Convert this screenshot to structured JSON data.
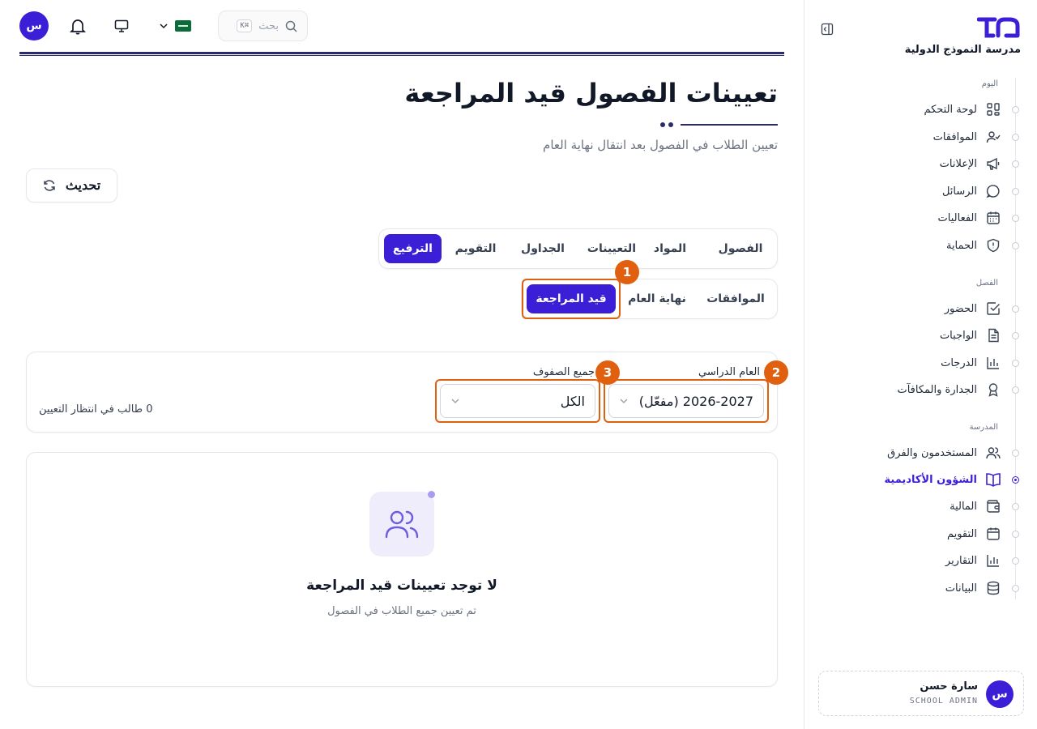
{
  "sidebar": {
    "school_name": "مدرسة النموذج الدولية",
    "sections": [
      {
        "title": "اليوم",
        "items": [
          {
            "label": "لوحة التحكم",
            "icon": "dashboard-icon"
          },
          {
            "label": "الموافقات",
            "icon": "user-check-icon"
          },
          {
            "label": "الإعلانات",
            "icon": "megaphone-icon"
          },
          {
            "label": "الرسائل",
            "icon": "chat-bubble-icon"
          },
          {
            "label": "الفعاليات",
            "icon": "calendar-grid-icon"
          },
          {
            "label": "الحماية",
            "icon": "shield-icon"
          }
        ]
      },
      {
        "title": "الفصل",
        "items": [
          {
            "label": "الحضور",
            "icon": "checkbox-icon"
          },
          {
            "label": "الواجبات",
            "icon": "document-icon"
          },
          {
            "label": "الدرجات",
            "icon": "bar-chart-icon"
          },
          {
            "label": "الجدارة والمكافآت",
            "icon": "award-icon"
          }
        ]
      },
      {
        "title": "المدرسة",
        "items": [
          {
            "label": "المستخدمون والفرق",
            "icon": "users-icon"
          },
          {
            "label": "الشؤون الأكاديمية",
            "icon": "book-open-icon"
          },
          {
            "label": "المالية",
            "icon": "wallet-icon"
          },
          {
            "label": "التقويم",
            "icon": "calendar-icon"
          },
          {
            "label": "التقارير",
            "icon": "report-chart-icon"
          },
          {
            "label": "البيانات",
            "icon": "database-icon"
          }
        ]
      }
    ],
    "active_item": "الشؤون الأكاديمية",
    "user": {
      "initial": "س",
      "name": "سارة حسن",
      "role": "SCHOOL ADMIN"
    }
  },
  "topbar": {
    "avatar_initial": "س",
    "search_placeholder": "بحث",
    "search_shortcut": "K⌘"
  },
  "header": {
    "title": "تعيينات الفصول قيد المراجعة",
    "subtitle": "تعيين الطلاب في الفصول بعد انتقال نهاية العام",
    "refresh_label": "تحديث"
  },
  "tabs_main": [
    {
      "label": "الفصول",
      "active": false
    },
    {
      "label": "المواد",
      "active": false
    },
    {
      "label": "التعيينات",
      "active": false
    },
    {
      "label": "الجداول",
      "active": false
    },
    {
      "label": "التقويم",
      "active": false
    },
    {
      "label": "الترفيع",
      "active": true
    }
  ],
  "tabs_sub": [
    {
      "label": "الموافقات",
      "active": false
    },
    {
      "label": "نهاية العام",
      "active": false
    },
    {
      "label": "قيد المراجعة",
      "active": true
    }
  ],
  "filters": {
    "year_label": "العام الدراسي",
    "year_value": "2026-2027 (مفعّل)",
    "grade_label": "جميع الصفوف",
    "grade_value": "الكل",
    "pending_count": "0 طالب في انتظار التعيين"
  },
  "empty_state": {
    "title": "لا توجد تعيينات قيد المراجعة",
    "subtitle": "تم تعيين جميع الطلاب في الفصول"
  },
  "annotations": [
    "1",
    "2",
    "3"
  ],
  "colors": {
    "accent": "#3b1fd6",
    "highlight": "#e0600f"
  }
}
